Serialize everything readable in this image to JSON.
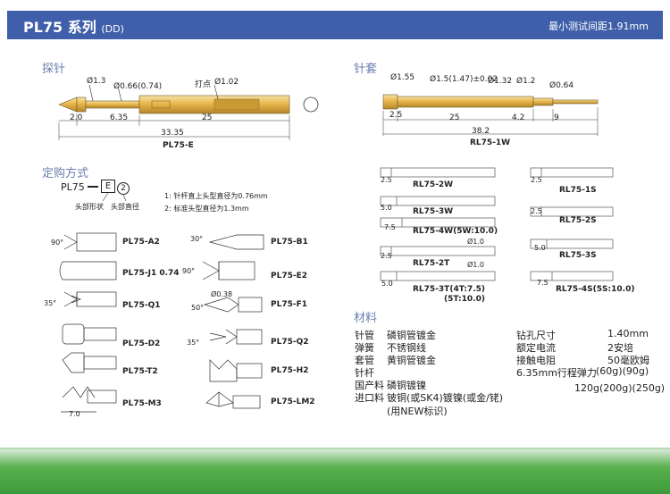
{
  "header": {
    "title": "PL75 系列",
    "title_suffix": "(DD)",
    "spec": "最小测试间距1.91mm"
  },
  "probe": {
    "section": "探针",
    "dims": {
      "tip_dia": "Ø1.3",
      "body_dia": "Ø0.66(0.74)",
      "crimp": "打点",
      "barrel_dia": "Ø1.02",
      "d1": "2.0",
      "d2": "6.35",
      "d3": "25",
      "total": "33.35"
    },
    "model": "PL75-E"
  },
  "receptacle": {
    "section": "针套",
    "dims": {
      "d1": "Ø1.55",
      "d2": "Ø1.5(1.47)±0.02",
      "d3": "Ø1.32",
      "d4": "Ø1.2",
      "d5": "Ø0.64",
      "l1": "2.5",
      "l2": "25",
      "l3": "4.2",
      "l4": "9",
      "total": "38.2"
    },
    "model": "RL75-1W"
  },
  "ordering": {
    "section": "定购方式",
    "code_prefix": "PL75",
    "code_e": "E",
    "code_2": "2",
    "label_head": "头部形状",
    "label_dia": "头部直径",
    "note1": "1: 针杆直上头型直径为0.76mm",
    "note2": "2: 标准头型直径为1.3mm"
  },
  "tips_left": [
    {
      "code": "PL75-A2",
      "angle": "90°"
    },
    {
      "code": "PL75-J1 0.74",
      "angle": ""
    },
    {
      "code": "PL75-Q1",
      "angle": "35°"
    },
    {
      "code": "PL75-D2",
      "angle": ""
    },
    {
      "code": "PL75-T2",
      "angle": ""
    },
    {
      "code": "PL75-M3",
      "angle": ""
    }
  ],
  "tips_left_dim": "7.0",
  "tips_right": [
    {
      "code": "PL75-B1",
      "angle": "30°"
    },
    {
      "code": "PL75-E2",
      "angle": "90°"
    },
    {
      "code": "PL75-F1",
      "angle": "50°",
      "dia": "Ø0.38"
    },
    {
      "code": "PL75-Q2",
      "angle": "35°"
    },
    {
      "code": "PL75-H2",
      "angle": ""
    },
    {
      "code": "PL75-LM2",
      "angle": ""
    }
  ],
  "receptacles_left": [
    {
      "code": "RL75-2W",
      "dim": "2.5"
    },
    {
      "code": "RL75-3W",
      "dim": "5.0"
    },
    {
      "code": "RL75-4W(5W:10.0)",
      "dim": "7.5"
    },
    {
      "code": "RL75-2T",
      "dim": "2.5",
      "dia": "Ø1.0"
    },
    {
      "code": "RL75-3T(4T:7.5)",
      "code2": "(5T:10.0)",
      "dim": "5.0",
      "dia": "Ø1.0"
    }
  ],
  "receptacles_right": [
    {
      "code": "RL75-1S",
      "dim": "2.5"
    },
    {
      "code": "RL75-2S",
      "dim": "2.5"
    },
    {
      "code": "RL75-3S",
      "dim": "5.0"
    },
    {
      "code": "RL75-4S(5S:10.0)",
      "dim": "7.5"
    }
  ],
  "materials": {
    "section": "材料",
    "rows": [
      {
        "k": "针管",
        "v": "磷铜管镀金"
      },
      {
        "k": "弹簧",
        "v": "不锈钢线"
      },
      {
        "k": "套管",
        "v": "黄铜管镀金"
      },
      {
        "k": "针杆",
        "v": ""
      },
      {
        "k": "国产料",
        "v": "磷铜镀镍"
      },
      {
        "k": "进口料",
        "v": "铍铜(或SK4)镀镍(或金/铑)"
      },
      {
        "k": "",
        "v": "(用NEW标识)"
      }
    ],
    "specs": [
      {
        "k": "钻孔尺寸",
        "v": "1.40mm"
      },
      {
        "k": "额定电流",
        "v": "2安培"
      },
      {
        "k": "接触电阻",
        "v": "50毫欧姆"
      },
      {
        "k": "6.35mm行程弹力",
        "v": "(60g)(90g)"
      },
      {
        "k": "",
        "v": "120g(200g)(250g)"
      }
    ]
  },
  "colors": {
    "header": "#3f5faa",
    "section": "#6a7fae",
    "gold": "#e2b24a",
    "footer": "#4aa844"
  }
}
